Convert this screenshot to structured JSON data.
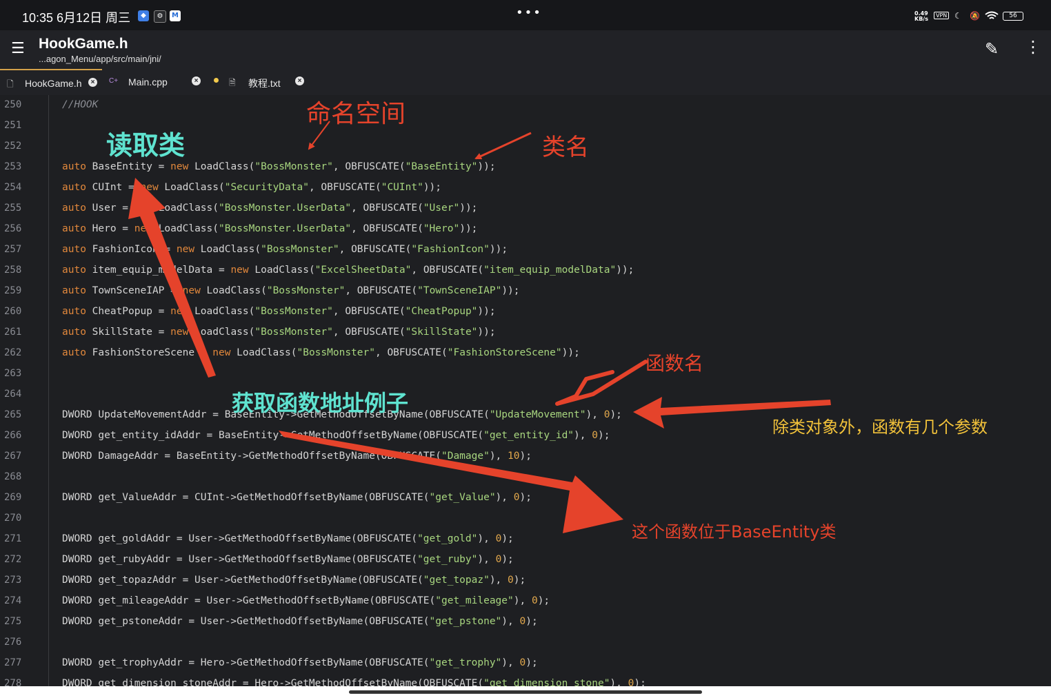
{
  "status_bar": {
    "time": "10:35  6月12日 周三",
    "net_speed_top": "0.49",
    "net_speed_bottom": "KB/s",
    "vpn": "VPN",
    "battery": "56"
  },
  "app_bar": {
    "title": "HookGame.h",
    "path": "...agon_Menu/app/src/main/jni/"
  },
  "tabs": [
    {
      "label": "HookGame.h",
      "icon": "file-icon"
    },
    {
      "label": "Main.cpp",
      "icon": "cpp-file-icon"
    },
    {
      "label": "教程.txt",
      "icon": "text-file-icon"
    }
  ],
  "code_lines": [
    {
      "n": "250",
      "tokens": [
        {
          "t": "//HOOK",
          "c": "cm"
        }
      ]
    },
    {
      "n": "251",
      "tokens": []
    },
    {
      "n": "252",
      "tokens": []
    },
    {
      "n": "253",
      "tokens": [
        {
          "t": "auto",
          "c": "kw"
        },
        {
          "t": " BaseEntity = ",
          "c": ""
        },
        {
          "t": "new",
          "c": "kw"
        },
        {
          "t": " LoadClass(",
          "c": ""
        },
        {
          "t": "\"BossMonster\"",
          "c": "str"
        },
        {
          "t": ", OBFUSCATE(",
          "c": ""
        },
        {
          "t": "\"BaseEntity\"",
          "c": "str"
        },
        {
          "t": "));",
          "c": ""
        }
      ]
    },
    {
      "n": "254",
      "tokens": [
        {
          "t": "auto",
          "c": "kw"
        },
        {
          "t": " CUInt = ",
          "c": ""
        },
        {
          "t": "new",
          "c": "kw"
        },
        {
          "t": " LoadClass(",
          "c": ""
        },
        {
          "t": "\"SecurityData\"",
          "c": "str"
        },
        {
          "t": ", OBFUSCATE(",
          "c": ""
        },
        {
          "t": "\"CUInt\"",
          "c": "str"
        },
        {
          "t": "));",
          "c": ""
        }
      ]
    },
    {
      "n": "255",
      "tokens": [
        {
          "t": "auto",
          "c": "kw"
        },
        {
          "t": " User = ",
          "c": ""
        },
        {
          "t": "new",
          "c": "kw"
        },
        {
          "t": " LoadClass(",
          "c": ""
        },
        {
          "t": "\"BossMonster.UserData\"",
          "c": "str"
        },
        {
          "t": ", OBFUSCATE(",
          "c": ""
        },
        {
          "t": "\"User\"",
          "c": "str"
        },
        {
          "t": "));",
          "c": ""
        }
      ]
    },
    {
      "n": "256",
      "tokens": [
        {
          "t": "auto",
          "c": "kw"
        },
        {
          "t": " Hero = ",
          "c": ""
        },
        {
          "t": "new",
          "c": "kw"
        },
        {
          "t": " LoadClass(",
          "c": ""
        },
        {
          "t": "\"BossMonster.UserData\"",
          "c": "str"
        },
        {
          "t": ", OBFUSCATE(",
          "c": ""
        },
        {
          "t": "\"Hero\"",
          "c": "str"
        },
        {
          "t": "));",
          "c": ""
        }
      ]
    },
    {
      "n": "257",
      "tokens": [
        {
          "t": "auto",
          "c": "kw"
        },
        {
          "t": " FashionIcon = ",
          "c": ""
        },
        {
          "t": "new",
          "c": "kw"
        },
        {
          "t": " LoadClass(",
          "c": ""
        },
        {
          "t": "\"BossMonster\"",
          "c": "str"
        },
        {
          "t": ", OBFUSCATE(",
          "c": ""
        },
        {
          "t": "\"FashionIcon\"",
          "c": "str"
        },
        {
          "t": "));",
          "c": ""
        }
      ]
    },
    {
      "n": "258",
      "tokens": [
        {
          "t": "auto",
          "c": "kw"
        },
        {
          "t": " item_equip_modelData = ",
          "c": ""
        },
        {
          "t": "new",
          "c": "kw"
        },
        {
          "t": " LoadClass(",
          "c": ""
        },
        {
          "t": "\"ExcelSheetData\"",
          "c": "str"
        },
        {
          "t": ", OBFUSCATE(",
          "c": ""
        },
        {
          "t": "\"item_equip_modelData\"",
          "c": "str"
        },
        {
          "t": "));",
          "c": ""
        }
      ]
    },
    {
      "n": "259",
      "tokens": [
        {
          "t": "auto",
          "c": "kw"
        },
        {
          "t": " TownSceneIAP = ",
          "c": ""
        },
        {
          "t": "new",
          "c": "kw"
        },
        {
          "t": " LoadClass(",
          "c": ""
        },
        {
          "t": "\"BossMonster\"",
          "c": "str"
        },
        {
          "t": ", OBFUSCATE(",
          "c": ""
        },
        {
          "t": "\"TownSceneIAP\"",
          "c": "str"
        },
        {
          "t": "));",
          "c": ""
        }
      ]
    },
    {
      "n": "260",
      "tokens": [
        {
          "t": "auto",
          "c": "kw"
        },
        {
          "t": " CheatPopup = ",
          "c": ""
        },
        {
          "t": "new",
          "c": "kw"
        },
        {
          "t": " LoadClass(",
          "c": ""
        },
        {
          "t": "\"BossMonster\"",
          "c": "str"
        },
        {
          "t": ", OBFUSCATE(",
          "c": ""
        },
        {
          "t": "\"CheatPopup\"",
          "c": "str"
        },
        {
          "t": "));",
          "c": ""
        }
      ]
    },
    {
      "n": "261",
      "tokens": [
        {
          "t": "auto",
          "c": "kw"
        },
        {
          "t": " SkillState = ",
          "c": ""
        },
        {
          "t": "new",
          "c": "kw"
        },
        {
          "t": " LoadClass(",
          "c": ""
        },
        {
          "t": "\"BossMonster\"",
          "c": "str"
        },
        {
          "t": ", OBFUSCATE(",
          "c": ""
        },
        {
          "t": "\"SkillState\"",
          "c": "str"
        },
        {
          "t": "));",
          "c": ""
        }
      ]
    },
    {
      "n": "262",
      "tokens": [
        {
          "t": "auto",
          "c": "kw"
        },
        {
          "t": " FashionStoreScene = ",
          "c": ""
        },
        {
          "t": "new",
          "c": "kw"
        },
        {
          "t": " LoadClass(",
          "c": ""
        },
        {
          "t": "\"BossMonster\"",
          "c": "str"
        },
        {
          "t": ", OBFUSCATE(",
          "c": ""
        },
        {
          "t": "\"FashionStoreScene\"",
          "c": "str"
        },
        {
          "t": "));",
          "c": ""
        }
      ]
    },
    {
      "n": "263",
      "tokens": []
    },
    {
      "n": "264",
      "tokens": []
    },
    {
      "n": "265",
      "tokens": [
        {
          "t": "DWORD UpdateMovementAddr = BaseEntity->GetMethodOffsetByName(OBFUSCATE(",
          "c": ""
        },
        {
          "t": "\"UpdateMovement\"",
          "c": "str"
        },
        {
          "t": "), ",
          "c": ""
        },
        {
          "t": "0",
          "c": "num"
        },
        {
          "t": ");",
          "c": ""
        }
      ]
    },
    {
      "n": "266",
      "tokens": [
        {
          "t": "DWORD get_entity_idAddr = BaseEntity->GetMethodOffsetByName(OBFUSCATE(",
          "c": ""
        },
        {
          "t": "\"get_entity_id\"",
          "c": "str"
        },
        {
          "t": "), ",
          "c": ""
        },
        {
          "t": "0",
          "c": "num"
        },
        {
          "t": ");",
          "c": ""
        }
      ]
    },
    {
      "n": "267",
      "tokens": [
        {
          "t": "DWORD DamageAddr = BaseEntity->GetMethodOffsetByName(OBFUSCATE(",
          "c": ""
        },
        {
          "t": "\"Damage\"",
          "c": "str"
        },
        {
          "t": "), ",
          "c": ""
        },
        {
          "t": "10",
          "c": "num"
        },
        {
          "t": ");",
          "c": ""
        }
      ]
    },
    {
      "n": "268",
      "tokens": []
    },
    {
      "n": "269",
      "tokens": [
        {
          "t": "DWORD get_ValueAddr = CUInt->GetMethodOffsetByName(OBFUSCATE(",
          "c": ""
        },
        {
          "t": "\"get_Value\"",
          "c": "str"
        },
        {
          "t": "), ",
          "c": ""
        },
        {
          "t": "0",
          "c": "num"
        },
        {
          "t": ");",
          "c": ""
        }
      ]
    },
    {
      "n": "270",
      "tokens": []
    },
    {
      "n": "271",
      "tokens": [
        {
          "t": "DWORD get_goldAddr = User->GetMethodOffsetByName(OBFUSCATE(",
          "c": ""
        },
        {
          "t": "\"get_gold\"",
          "c": "str"
        },
        {
          "t": "), ",
          "c": ""
        },
        {
          "t": "0",
          "c": "num"
        },
        {
          "t": ");",
          "c": ""
        }
      ]
    },
    {
      "n": "272",
      "tokens": [
        {
          "t": "DWORD get_rubyAddr = User->GetMethodOffsetByName(OBFUSCATE(",
          "c": ""
        },
        {
          "t": "\"get_ruby\"",
          "c": "str"
        },
        {
          "t": "), ",
          "c": ""
        },
        {
          "t": "0",
          "c": "num"
        },
        {
          "t": ");",
          "c": ""
        }
      ]
    },
    {
      "n": "273",
      "tokens": [
        {
          "t": "DWORD get_topazAddr = User->GetMethodOffsetByName(OBFUSCATE(",
          "c": ""
        },
        {
          "t": "\"get_topaz\"",
          "c": "str"
        },
        {
          "t": "), ",
          "c": ""
        },
        {
          "t": "0",
          "c": "num"
        },
        {
          "t": ");",
          "c": ""
        }
      ]
    },
    {
      "n": "274",
      "tokens": [
        {
          "t": "DWORD get_mileageAddr = User->GetMethodOffsetByName(OBFUSCATE(",
          "c": ""
        },
        {
          "t": "\"get_mileage\"",
          "c": "str"
        },
        {
          "t": "), ",
          "c": ""
        },
        {
          "t": "0",
          "c": "num"
        },
        {
          "t": ");",
          "c": ""
        }
      ]
    },
    {
      "n": "275",
      "tokens": [
        {
          "t": "DWORD get_pstoneAddr = User->GetMethodOffsetByName(OBFUSCATE(",
          "c": ""
        },
        {
          "t": "\"get_pstone\"",
          "c": "str"
        },
        {
          "t": "), ",
          "c": ""
        },
        {
          "t": "0",
          "c": "num"
        },
        {
          "t": ");",
          "c": ""
        }
      ]
    },
    {
      "n": "276",
      "tokens": []
    },
    {
      "n": "277",
      "tokens": [
        {
          "t": "DWORD get_trophyAddr = Hero->GetMethodOffsetByName(OBFUSCATE(",
          "c": ""
        },
        {
          "t": "\"get_trophy\"",
          "c": "str"
        },
        {
          "t": "), ",
          "c": ""
        },
        {
          "t": "0",
          "c": "num"
        },
        {
          "t": ");",
          "c": ""
        }
      ]
    },
    {
      "n": "278",
      "tokens": [
        {
          "t": "DWORD get_dimension_stoneAddr = Hero->GetMethodOffsetByName(OBFUSCATE(",
          "c": ""
        },
        {
          "t": "\"get_dimension_stone\"",
          "c": "str"
        },
        {
          "t": "), ",
          "c": ""
        },
        {
          "t": "0",
          "c": "num"
        },
        {
          "t": ");",
          "c": ""
        }
      ]
    }
  ],
  "annotations": {
    "namespace": "命名空间",
    "read_class": "读取类",
    "class_name": "类名",
    "function_name": "函数名",
    "get_function_example": "获取函数地址例子",
    "param_count": "除类对象外，函数有几个参数",
    "in_class": "这个函数位于BaseEntity类"
  },
  "colors": {
    "keyword": "#e2883c",
    "string": "#a8d67f",
    "number": "#e2a84c",
    "annotation_red": "#e5432b",
    "annotation_cyan": "#5fe3d0",
    "annotation_yellow": "#f2c23a"
  }
}
